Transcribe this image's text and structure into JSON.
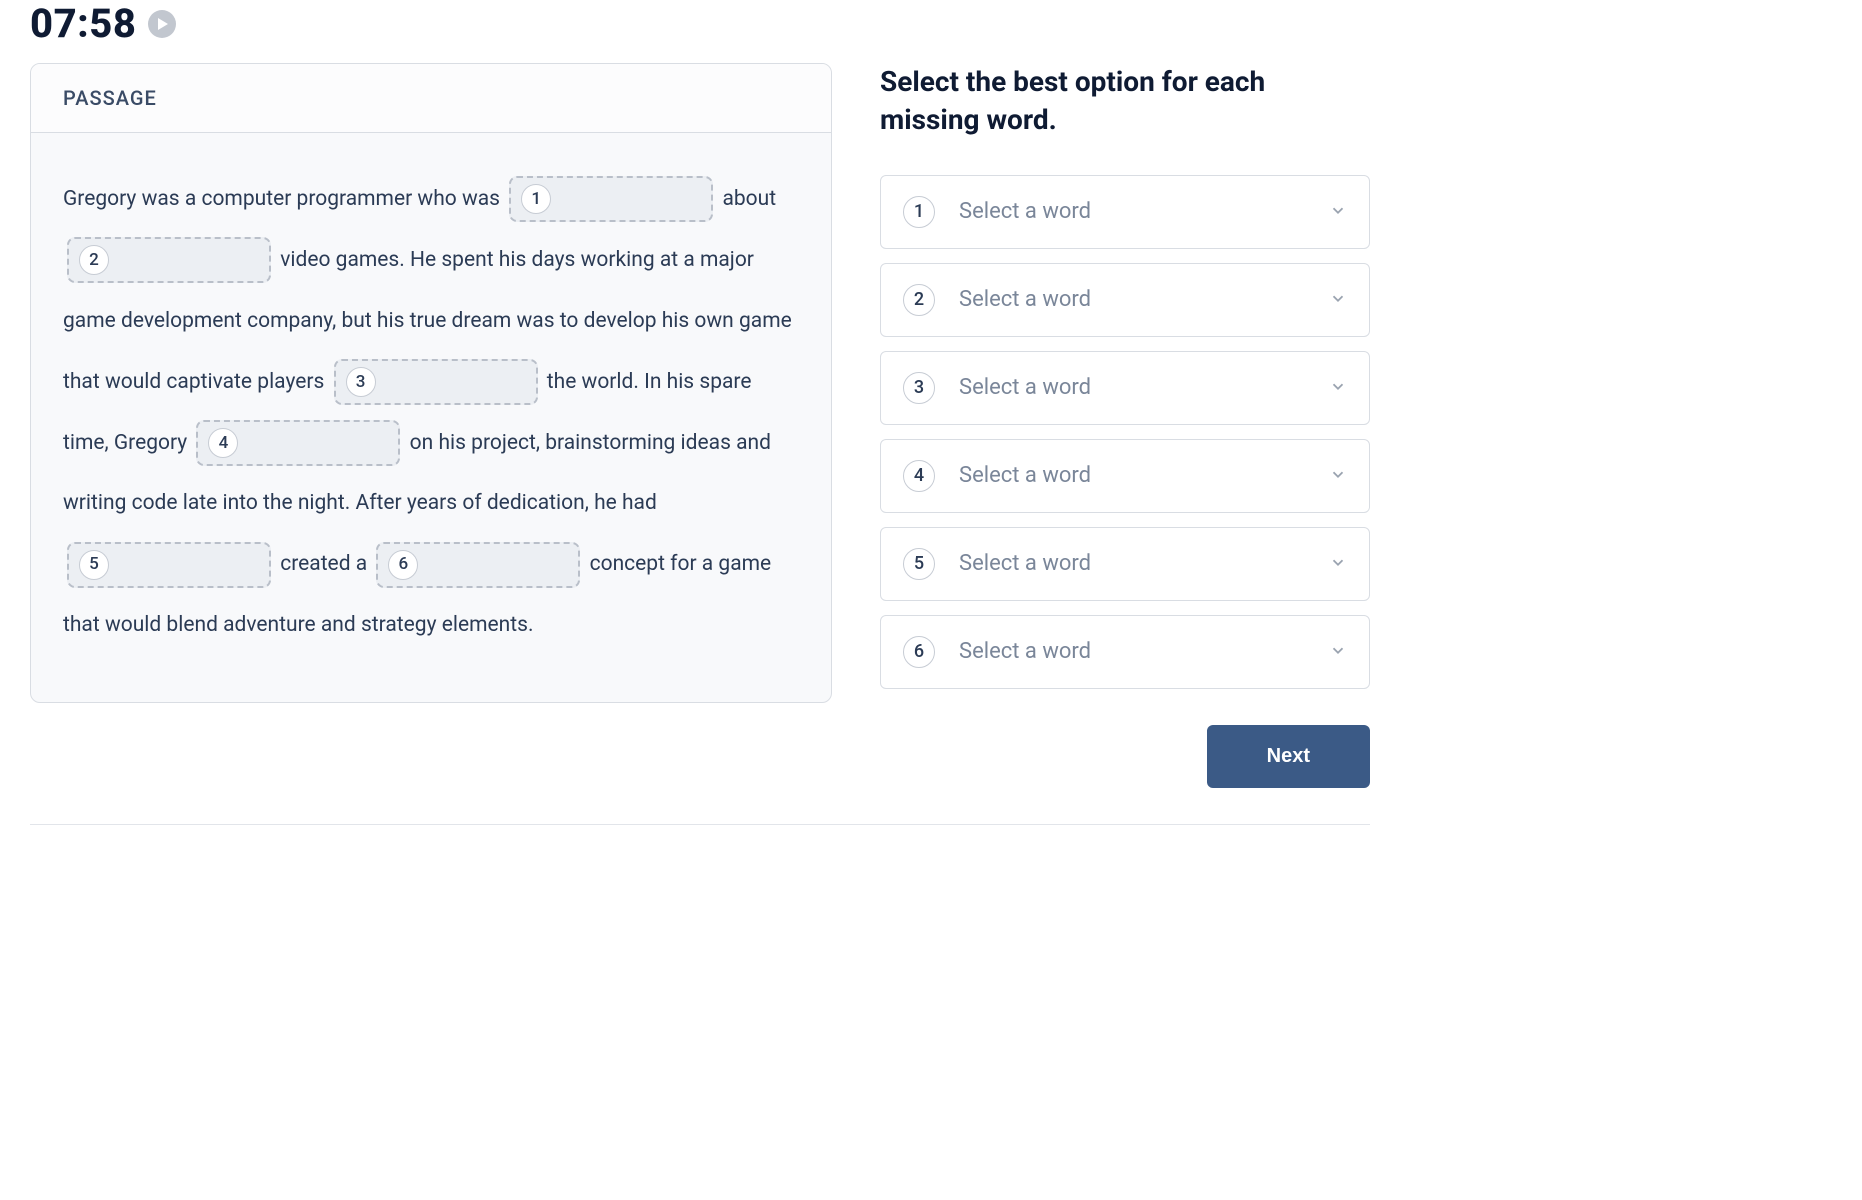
{
  "timer": "07:58",
  "passage": {
    "header": "PASSAGE",
    "segments": [
      "Gregory was a computer programmer who was ",
      " about ",
      " video games. He spent his days working at a major game development company, but his true dream was to develop his own game that would captivate players ",
      " the world. In his spare time, Gregory ",
      " on his project, brainstorming ideas and writing code late into the night. After years of dedication, he had ",
      " created a ",
      " concept for a game that would blend adventure and strategy elements."
    ],
    "blanks": [
      "1",
      "2",
      "3",
      "4",
      "5",
      "6"
    ]
  },
  "instructions": "Select the best option for each missing word.",
  "selects": [
    {
      "num": "1",
      "placeholder": "Select a word"
    },
    {
      "num": "2",
      "placeholder": "Select a word"
    },
    {
      "num": "3",
      "placeholder": "Select a word"
    },
    {
      "num": "4",
      "placeholder": "Select a word"
    },
    {
      "num": "5",
      "placeholder": "Select a word"
    },
    {
      "num": "6",
      "placeholder": "Select a word"
    }
  ],
  "next_label": "Next"
}
